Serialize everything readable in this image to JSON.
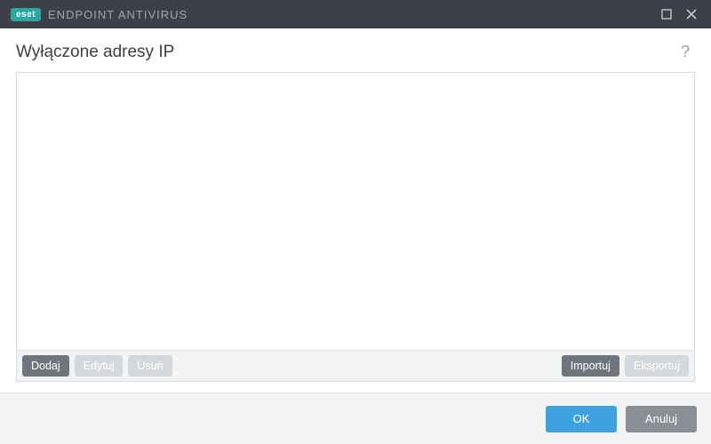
{
  "titlebar": {
    "brand_badge": "eset",
    "brand_text": "ENDPOINT ANTIVIRUS"
  },
  "header": {
    "title": "Wyłączone adresy IP",
    "help_symbol": "?"
  },
  "list": {
    "items": []
  },
  "list_toolbar": {
    "add": "Dodaj",
    "edit": "Edytuj",
    "remove": "Usuń",
    "import": "Importuj",
    "export": "Eksportuj"
  },
  "footer": {
    "ok": "OK",
    "cancel": "Anuluj"
  }
}
